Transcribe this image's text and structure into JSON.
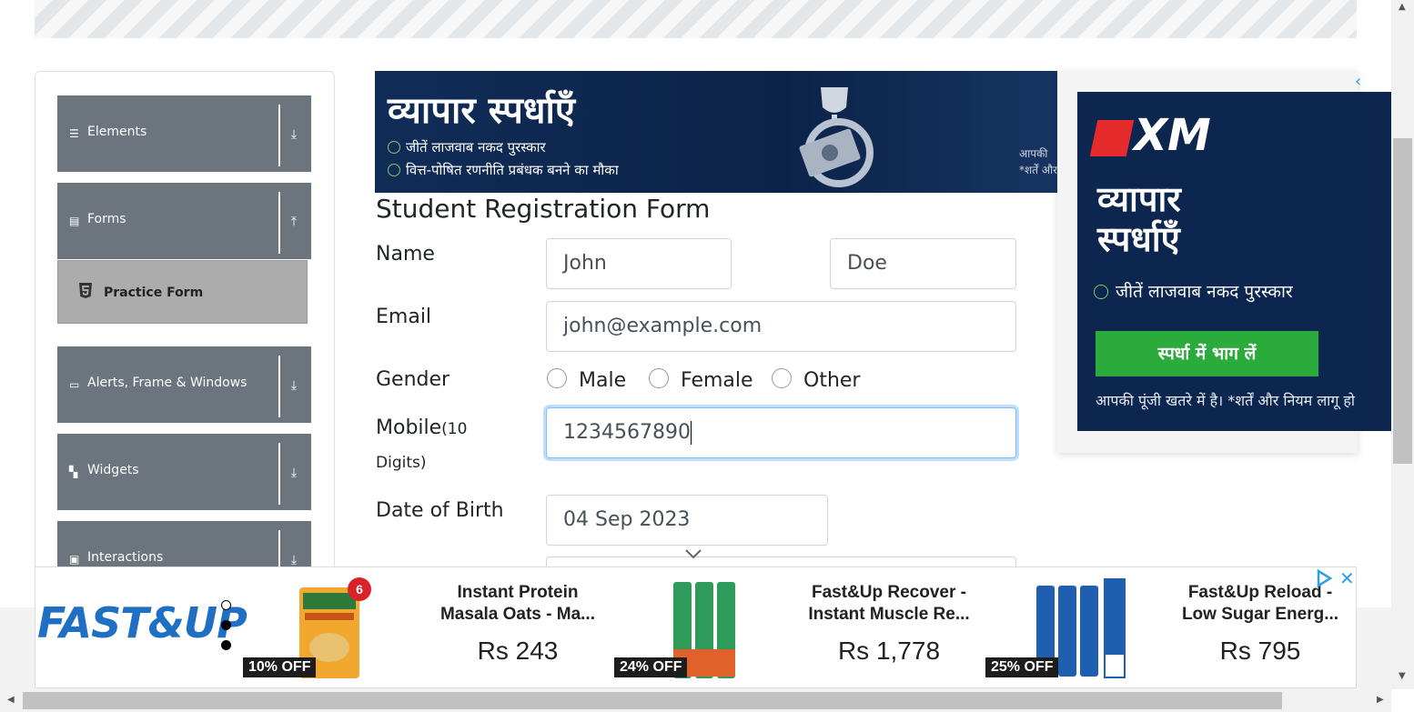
{
  "sidebar": {
    "groups": [
      {
        "label": "Elements",
        "icon": "menu-icon",
        "arrow": "⤓"
      },
      {
        "label": "Forms",
        "icon": "document-icon",
        "arrow": "⤒"
      },
      {
        "label": "Alerts, Frame & Windows",
        "icon": "window-icon",
        "arrow": "⤓"
      },
      {
        "label": "Widgets",
        "icon": "widgets-icon",
        "arrow": "⤓"
      },
      {
        "label": "Interactions",
        "icon": "interactions-icon",
        "arrow": "⤓"
      }
    ],
    "active_item": "Practice Form"
  },
  "top_ad": {
    "title": "व्यापार स्पर्धाएँ",
    "line1": "जीतें लाजवाब नकद पुरस्कार",
    "line2": "वित्त-पोषित रणनीति प्रबंधक बनने का मौका",
    "foot1": "आपकी",
    "foot2": "*शर्तें और नि"
  },
  "side_ad": {
    "logo": "XM",
    "title_line1": "व्यापार",
    "title_line2": "स्पर्धाएँ",
    "line": "जीतें लाजवाब नकद पुरस्कार",
    "button": "स्पर्धा में भाग लें",
    "foot": "आपकी पूंजी खतरे में है। *शर्तें और नियम लागू हो"
  },
  "form": {
    "title": "Student Registration Form",
    "name_label": "Name",
    "first_name": "John",
    "last_name": "Doe",
    "email_label": "Email",
    "email": "john@example.com",
    "gender_label": "Gender",
    "gender_options": [
      "Male",
      "Female",
      "Other"
    ],
    "mobile_label": "Mobile",
    "mobile_hint": "(10",
    "mobile_hint2": "Digits)",
    "mobile": "1234567890",
    "dob_label": "Date of Birth",
    "dob": "04 Sep 2023"
  },
  "bottom_ad": {
    "brand": "FAST&UP",
    "products": [
      {
        "name": "Instant Protein Masala Oats - Ma...",
        "price": "Rs 243",
        "discount": "10% OFF",
        "badge": "6"
      },
      {
        "name": "Fast&Up Recover - Instant Muscle Re...",
        "price": "Rs 1,778",
        "discount": "24% OFF"
      },
      {
        "name": "Fast&Up Reload - Low Sugar Energ...",
        "price": "Rs 795",
        "discount": "25% OFF"
      }
    ]
  },
  "colors": {
    "sidebar_header": "#6c757d",
    "active_item": "#acacac",
    "ad_navy": "#0d2650",
    "ad_green": "#2bab3b",
    "brand_blue": "#1f6fc4",
    "focus_border": "#80bdff"
  }
}
